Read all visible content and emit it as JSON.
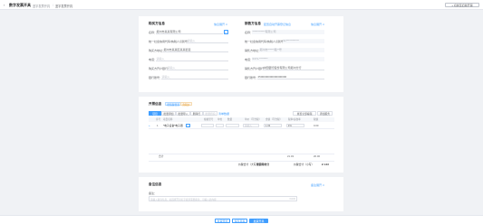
{
  "header": {
    "back_icon": "chevron-left-icon",
    "title": "数字发票开具",
    "crumbs": [
      "蓝字发票开具",
      "蓝字发票开具"
    ],
    "right_button": "+ 切换至旧版开票"
  },
  "buyer": {
    "title": "购买方信息",
    "link": "信息展开 ∨",
    "name_label": "名称：",
    "name_value": "郑州市某某有限公司",
    "taxid_label": "统一社会信用代码/纳税人识别号：",
    "taxid_placeholder": "请输入",
    "address_label": "购买方地址：",
    "address_value": "郑州市某某区某某街道",
    "phone_label": "电话：",
    "phone_placeholder": "请输入",
    "bank_label": "购买方开户银行：",
    "bank_placeholder": "请输入",
    "account_label": "银行账号：",
    "account_placeholder": "请输入"
  },
  "seller": {
    "title": "销售方信息",
    "link_extra": "配置自动开票登记信息",
    "link": "信息展开 ∨",
    "name_label": "名称：",
    "name_value": "************有限公司",
    "taxid_label": "统一社会信用代码/纳税人识别号：",
    "taxid_value": "91************",
    "address_label": "销售方地址：",
    "address_value": "郑州市******路**号",
    "phone_label": "电话：",
    "phone_value": "0371-********",
    "bank_label": "销售方开户银行：",
    "bank_value": "中国银行股份有限公司郑州分行",
    "account_label": "银行账号：",
    "account_value": "2500000000000000000"
  },
  "items": {
    "title": "开票信息",
    "tag_blue": "增值税普票",
    "tag_orange": "含税价",
    "tabs": [
      "项目",
      "批量添加",
      "批量导入",
      "删除行",
      "批量折扣"
    ],
    "tab_link": "清单数据",
    "right_buttons": [
      "重置全部编辑",
      "添加服务"
    ],
    "columns": [
      "序号",
      "项目名称",
      "规格型号",
      "单位",
      "数量",
      "单价（不含税）",
      "金额（不含税）",
      "税率/征收率",
      "税额"
    ],
    "rows": [
      {
        "index": "1",
        "name": "*电子设备*电子器",
        "spec": "",
        "unit": "",
        "qty": "",
        "price": "请输入",
        "amount": "1.03",
        "rate": "3%",
        "tax": "0.00"
      }
    ],
    "subtotal_label": "合计",
    "subtotal_amount": "¥1.03",
    "subtotal_tax": "¥0.00",
    "total_words_label": "价税合计（大写）",
    "total_words_value": "壹圆零叁分",
    "total_figure_label": "价税合计（小写）",
    "total_figure_value": "¥ 1.03"
  },
  "remarks": {
    "title": "备注信息",
    "link": "备注展开 ∨",
    "label": "备注：",
    "placeholder": "请输入备注信息，如选择开具红字发票需要备注，可输入此内容",
    "counter": "0/230"
  },
  "footer": {
    "buttons": [
      "发票预览",
      "保存草稿",
      "发票开具"
    ]
  },
  "colors": {
    "accent": "#409eff",
    "orange": "#e6a23c"
  }
}
